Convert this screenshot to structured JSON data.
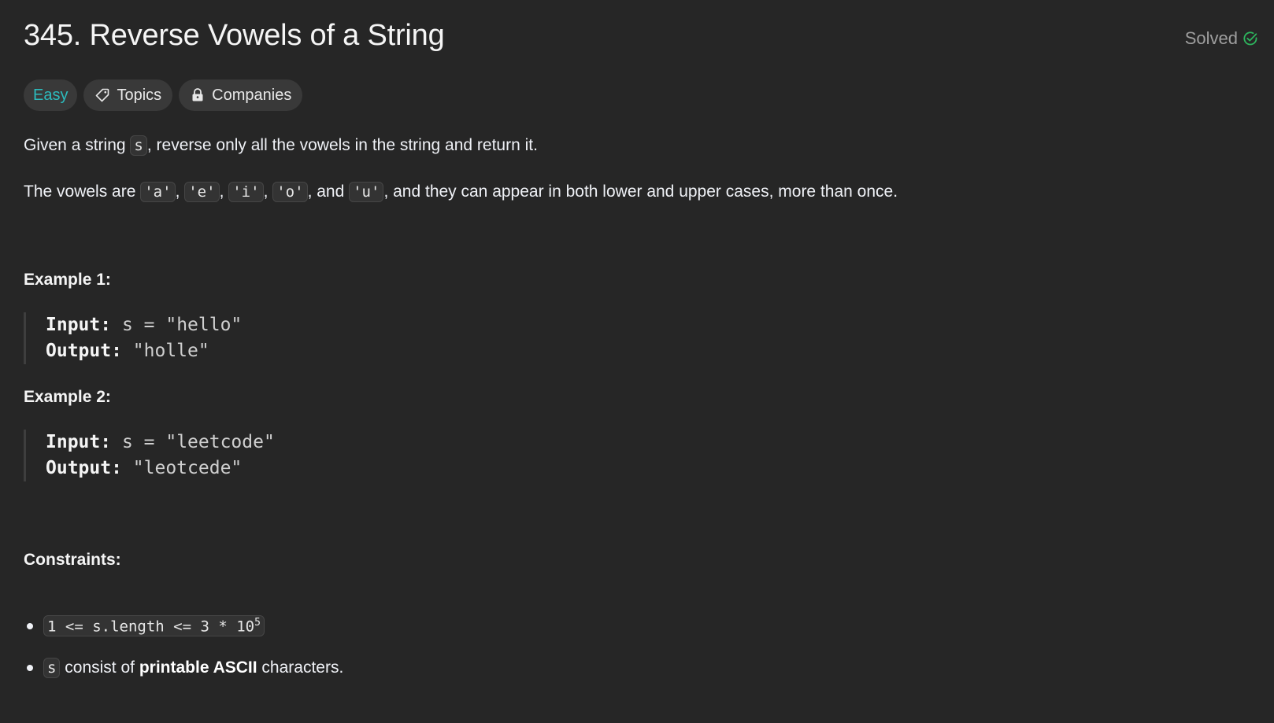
{
  "problem": {
    "title": "345. Reverse Vowels of a String",
    "status": "Solved"
  },
  "tags": {
    "difficulty": "Easy",
    "topics": "Topics",
    "companies": "Companies"
  },
  "description": {
    "p1_before": "Given a string ",
    "p1_code": "s",
    "p1_after": ", reverse only all the vowels in the string and return it.",
    "p2_before": "The vowels are ",
    "vowels": [
      "'a'",
      "'e'",
      "'i'",
      "'o'",
      "'u'"
    ],
    "p2_sep": ", ",
    "p2_and": ", and ",
    "p2_after": ", and they can appear in both lower and upper cases, more than once."
  },
  "examples": [
    {
      "heading": "Example 1:",
      "input_label": "Input:",
      "input_value": "s = \"hello\"",
      "output_label": "Output:",
      "output_value": "\"holle\""
    },
    {
      "heading": "Example 2:",
      "input_label": "Input:",
      "input_value": "s = \"leetcode\"",
      "output_label": "Output:",
      "output_value": "\"leotcede\""
    }
  ],
  "constraints": {
    "heading": "Constraints:",
    "c1_code": "1 <= s.length <= 3 * 10",
    "c1_sup": "5",
    "c2_code": "s",
    "c2_mid": " consist of ",
    "c2_bold": "printable ASCII",
    "c2_after": " characters."
  },
  "colors": {
    "background": "#262626",
    "easy": "#2cbbbd",
    "solved_check": "#2db55d"
  },
  "icons": [
    "check-circle-icon",
    "tag-icon",
    "lock-icon"
  ]
}
